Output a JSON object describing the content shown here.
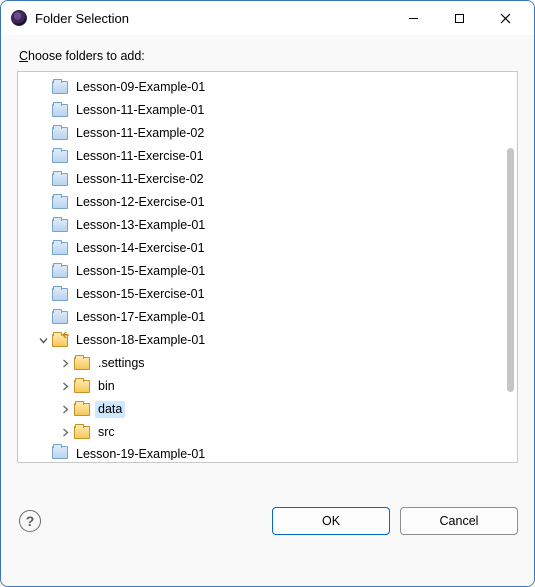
{
  "window": {
    "title": "Folder Selection"
  },
  "prompt": "Choose folders to add:",
  "tree": {
    "selected_path": "Lesson-18-Example-01/data",
    "items": [
      {
        "label": "Lesson-09-Example-01",
        "depth": 1,
        "expander": "none",
        "iconKind": "closed",
        "selected": false
      },
      {
        "label": "Lesson-11-Example-01",
        "depth": 1,
        "expander": "none",
        "iconKind": "closed",
        "selected": false
      },
      {
        "label": "Lesson-11-Example-02",
        "depth": 1,
        "expander": "none",
        "iconKind": "closed",
        "selected": false
      },
      {
        "label": "Lesson-11-Exercise-01",
        "depth": 1,
        "expander": "none",
        "iconKind": "closed",
        "selected": false
      },
      {
        "label": "Lesson-11-Exercise-02",
        "depth": 1,
        "expander": "none",
        "iconKind": "closed",
        "selected": false
      },
      {
        "label": "Lesson-12-Exercise-01",
        "depth": 1,
        "expander": "none",
        "iconKind": "closed",
        "selected": false
      },
      {
        "label": "Lesson-13-Example-01",
        "depth": 1,
        "expander": "none",
        "iconKind": "closed",
        "selected": false
      },
      {
        "label": "Lesson-14-Exercise-01",
        "depth": 1,
        "expander": "none",
        "iconKind": "closed",
        "selected": false
      },
      {
        "label": "Lesson-15-Example-01",
        "depth": 1,
        "expander": "none",
        "iconKind": "closed",
        "selected": false
      },
      {
        "label": "Lesson-15-Exercise-01",
        "depth": 1,
        "expander": "none",
        "iconKind": "closed",
        "selected": false
      },
      {
        "label": "Lesson-17-Example-01",
        "depth": 1,
        "expander": "none",
        "iconKind": "closed",
        "selected": false
      },
      {
        "label": "Lesson-18-Example-01",
        "depth": 1,
        "expander": "down",
        "iconKind": "open-badge",
        "selected": false
      },
      {
        "label": ".settings",
        "depth": 2,
        "expander": "right",
        "iconKind": "open",
        "selected": false
      },
      {
        "label": "bin",
        "depth": 2,
        "expander": "right",
        "iconKind": "open",
        "selected": false
      },
      {
        "label": "data",
        "depth": 2,
        "expander": "right",
        "iconKind": "open",
        "selected": true
      },
      {
        "label": "src",
        "depth": 2,
        "expander": "right",
        "iconKind": "open",
        "selected": false
      },
      {
        "label": "Lesson-19-Example-01",
        "depth": 1,
        "expander": "none",
        "iconKind": "closed",
        "selected": false,
        "cut": true
      }
    ]
  },
  "buttons": {
    "ok": "OK",
    "cancel": "Cancel"
  }
}
